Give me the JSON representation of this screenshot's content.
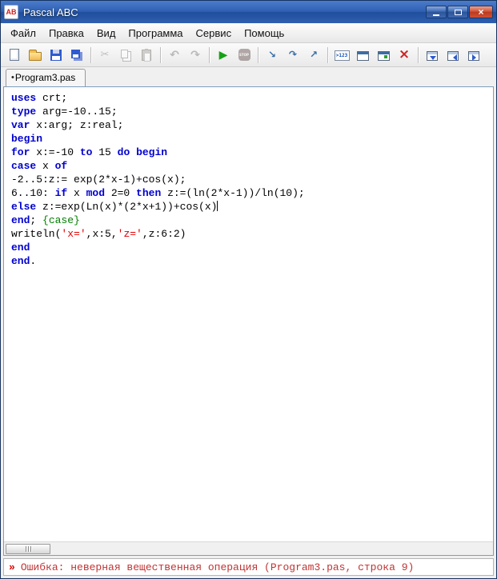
{
  "window": {
    "title": "Pascal ABC",
    "icon_label": "AB"
  },
  "colors": {
    "titlebar_accent": "#2f5fb2",
    "keyword": "#0000d0",
    "string": "#e00000",
    "comment": "#007d00",
    "error_text": "#c23333",
    "run_green": "#14a214",
    "stop_red": "#c7413a"
  },
  "menu": {
    "items": [
      {
        "id": "file",
        "label": "Файл"
      },
      {
        "id": "edit",
        "label": "Правка"
      },
      {
        "id": "view",
        "label": "Вид"
      },
      {
        "id": "program",
        "label": "Программа"
      },
      {
        "id": "service",
        "label": "Сервис"
      },
      {
        "id": "help",
        "label": "Помощь"
      }
    ]
  },
  "toolbar": {
    "items": [
      {
        "name": "new-file",
        "glyph": "page"
      },
      {
        "name": "open-file",
        "glyph": "folder"
      },
      {
        "name": "save-file",
        "glyph": "floppy"
      },
      {
        "name": "save-all",
        "glyph": "floppy-all"
      },
      {
        "type": "sep"
      },
      {
        "name": "cut",
        "glyph": "scissors",
        "disabled": true
      },
      {
        "name": "copy",
        "glyph": "copy",
        "disabled": true
      },
      {
        "name": "paste",
        "glyph": "paste",
        "disabled": true
      },
      {
        "type": "sep"
      },
      {
        "name": "undo",
        "glyph": "undo",
        "disabled": true
      },
      {
        "name": "redo",
        "glyph": "redo",
        "disabled": true
      },
      {
        "type": "sep"
      },
      {
        "name": "run",
        "glyph": "run"
      },
      {
        "name": "stop",
        "glyph": "stop",
        "disabled": true
      },
      {
        "type": "sep"
      },
      {
        "name": "step-into",
        "glyph": "step-into"
      },
      {
        "name": "step-over",
        "glyph": "step-over"
      },
      {
        "name": "step-out",
        "glyph": "step-out"
      },
      {
        "type": "sep"
      },
      {
        "name": "evaluate-expression",
        "glyph": "eval"
      },
      {
        "name": "output-window",
        "glyph": "window"
      },
      {
        "name": "modules-window",
        "glyph": "window2"
      },
      {
        "name": "close-output-window",
        "glyph": "close-red"
      },
      {
        "type": "sep"
      },
      {
        "name": "show-debug-panel",
        "glyph": "panel down"
      },
      {
        "name": "show-watch-panel",
        "glyph": "panel left"
      },
      {
        "name": "show-output-panel",
        "glyph": "panel right"
      }
    ]
  },
  "tab": {
    "marker": "•",
    "label": "Program3.pas"
  },
  "editor": {
    "lines": [
      [
        {
          "t": "kw",
          "s": "uses"
        },
        {
          "t": "pl",
          "s": " crt;"
        }
      ],
      [
        {
          "t": "kw",
          "s": "type"
        },
        {
          "t": "pl",
          "s": " arg=-10..15;"
        }
      ],
      [
        {
          "t": "kw",
          "s": "var"
        },
        {
          "t": "pl",
          "s": " x:arg; z:real;"
        }
      ],
      [
        {
          "t": "kw",
          "s": "begin"
        }
      ],
      [
        {
          "t": "kw",
          "s": "for"
        },
        {
          "t": "pl",
          "s": " x:=-10 "
        },
        {
          "t": "kw",
          "s": "to"
        },
        {
          "t": "pl",
          "s": " 15 "
        },
        {
          "t": "kw",
          "s": "do"
        },
        {
          "t": "pl",
          "s": " "
        },
        {
          "t": "kw",
          "s": "begin"
        }
      ],
      [
        {
          "t": "kw",
          "s": "case"
        },
        {
          "t": "pl",
          "s": " x "
        },
        {
          "t": "kw",
          "s": "of"
        }
      ],
      [
        {
          "t": "pl",
          "s": "-2..5:z:= exp(2*x-1)+cos(x);"
        }
      ],
      [
        {
          "t": "pl",
          "s": "6..10: "
        },
        {
          "t": "kw",
          "s": "if"
        },
        {
          "t": "pl",
          "s": " x "
        },
        {
          "t": "kw",
          "s": "mod"
        },
        {
          "t": "pl",
          "s": " 2=0 "
        },
        {
          "t": "kw",
          "s": "then"
        },
        {
          "t": "pl",
          "s": " z:=(ln(2*x-1))/ln(10);"
        }
      ],
      [
        {
          "t": "kw",
          "s": "else"
        },
        {
          "t": "pl",
          "s": " z:=exp(Ln(x)*(2*x+1))+cos(x)"
        },
        {
          "t": "caret",
          "s": ""
        }
      ],
      [
        {
          "t": "kw",
          "s": "end"
        },
        {
          "t": "pl",
          "s": "; "
        },
        {
          "t": "cmt",
          "s": "{case}"
        }
      ],
      [
        {
          "t": "pl",
          "s": "writeln("
        },
        {
          "t": "str",
          "s": "'x='"
        },
        {
          "t": "pl",
          "s": ",x:5,"
        },
        {
          "t": "str",
          "s": "'z='"
        },
        {
          "t": "pl",
          "s": ",z:6:2)"
        }
      ],
      [
        {
          "t": "kw",
          "s": "end"
        }
      ],
      [
        {
          "t": "kw",
          "s": "end"
        },
        {
          "t": "pl",
          "s": "."
        }
      ]
    ]
  },
  "statusbar": {
    "marker": "»",
    "message": "Ошибка: неверная вещественная операция (Program3.pas, строка 9)"
  }
}
